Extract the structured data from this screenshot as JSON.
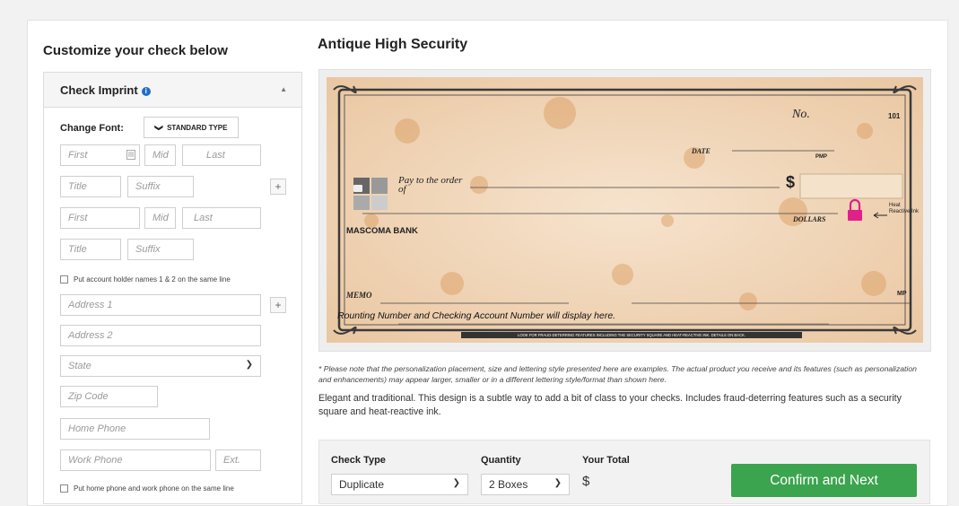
{
  "left": {
    "title": "Customize your check below",
    "panel_title": "Check Imprint",
    "info_icon": "i",
    "collapse_icon": "▲",
    "change_font_label": "Change Font:",
    "font_value": "STANDARD TYPE",
    "font_chevron": "❯",
    "name1": {
      "first": "First",
      "mid": "Mid",
      "last": "Last",
      "title": "Title",
      "suffix": "Suffix"
    },
    "name2": {
      "first": "First",
      "mid": "Mid",
      "last": "Last",
      "title": "Title",
      "suffix": "Suffix"
    },
    "add_icon": "+",
    "same_line_names": "Put account holder names 1 & 2 on the same line",
    "address1": "Address 1",
    "address2": "Address 2",
    "state": "State",
    "zip": "Zip Code",
    "home_phone": "Home Phone",
    "work_phone": "Work Phone",
    "ext": "Ext.",
    "same_line_phones": "Put home phone and work phone on the same line"
  },
  "right": {
    "title": "Antique High Security",
    "check": {
      "no_label": "No.",
      "number": "101",
      "date_label": "DATE",
      "date_mark": "PMP",
      "pay_label": "Pay to the order of",
      "dollar_sign": "$",
      "dollars_label": "DOLLARS",
      "heat_label": "Heat Reactive Ink",
      "bank": "MASCOMA BANK",
      "memo_label": "MEMO",
      "mp_mark": "MP",
      "micr_text": "Rounting Number and Checking Account Number will display here.",
      "bottom_strip": "LOOK FOR FRAUD-DETERRING FEATURES INCLUDING THE SECURITY SQUARE AND HEAT-REACTIVE INK. DETAILS ON BACK."
    },
    "note": "* Please note that the personalization placement, size and lettering style presented here are examples. The actual product you receive and its features (such as personalization and enhancements) may appear larger, smaller or in a different lettering style/format than shown here.",
    "description": "Elegant and traditional. This design is a subtle way to add a bit of class to your checks. Includes fraud-deterring features such as a security square and heat-reactive ink.",
    "order": {
      "check_type_label": "Check Type",
      "check_type_value": "Duplicate",
      "quantity_label": "Quantity",
      "quantity_value": "2 Boxes",
      "total_label": "Your Total",
      "total_value": "$",
      "confirm": "Confirm and Next"
    }
  }
}
